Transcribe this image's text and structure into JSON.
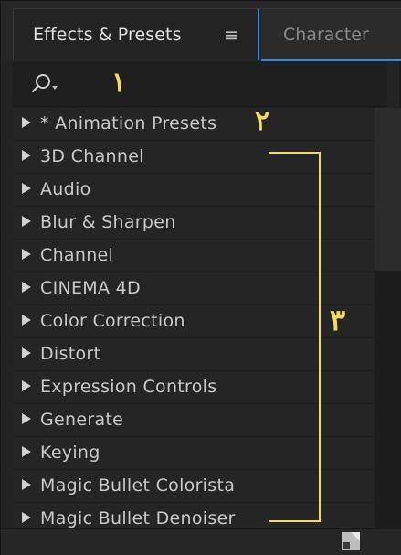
{
  "tabs": {
    "active": "Effects & Presets",
    "menu_icon": "hamburger-menu-icon",
    "other": "Character"
  },
  "search": {
    "icon": "search-icon",
    "annotation": "١"
  },
  "list": {
    "items": [
      {
        "label": "* Animation Presets"
      },
      {
        "label": "3D Channel"
      },
      {
        "label": "Audio"
      },
      {
        "label": "Blur & Sharpen"
      },
      {
        "label": "Channel"
      },
      {
        "label": "CINEMA 4D"
      },
      {
        "label": "Color Correction"
      },
      {
        "label": "Distort"
      },
      {
        "label": "Expression Controls"
      },
      {
        "label": "Generate"
      },
      {
        "label": "Keying"
      },
      {
        "label": "Magic Bullet Colorista"
      },
      {
        "label": "Magic Bullet Denoiser"
      }
    ]
  },
  "annotations": {
    "presets": "٢",
    "categories": "٣"
  },
  "colors": {
    "accent": "#2d8ceb",
    "annotation": "#f2dc5d"
  },
  "footer": {
    "icon": "new-bin-icon"
  }
}
